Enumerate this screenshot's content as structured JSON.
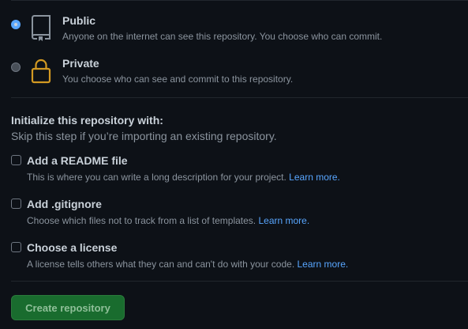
{
  "visibility": {
    "public": {
      "title": "Public",
      "description": "Anyone on the internet can see this repository. You choose who can commit.",
      "selected": true,
      "icon": "repo-icon"
    },
    "private": {
      "title": "Private",
      "description": "You choose who can see and commit to this repository.",
      "selected": false,
      "icon": "lock-icon"
    }
  },
  "initialize": {
    "title": "Initialize this repository with:",
    "subtitle": "Skip this step if you’re importing an existing repository.",
    "options": [
      {
        "title": "Add a README file",
        "description": "This is where you can write a long description for your project.",
        "link": "Learn more.",
        "checked": false
      },
      {
        "title": "Add .gitignore",
        "description": "Choose which files not to track from a list of templates.",
        "link": "Learn more.",
        "checked": false
      },
      {
        "title": "Choose a license",
        "description": "A license tells others what they can and can't do with your code.",
        "link": "Learn more.",
        "checked": false
      }
    ]
  },
  "actions": {
    "create_label": "Create repository"
  },
  "colors": {
    "background": "#0d1117",
    "accent": "#58a6ff",
    "button": "#196c2e",
    "icon_public": "#8b949e",
    "icon_private": "#d29922"
  }
}
